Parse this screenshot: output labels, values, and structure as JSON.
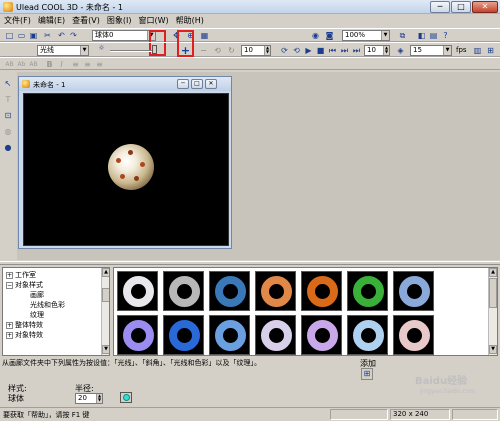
{
  "window": {
    "title": "Ulead COOL 3D - 未命名 - 1",
    "min": "─",
    "max": "□",
    "close": "✕"
  },
  "menu": [
    "文件(F)",
    "编辑(E)",
    "查看(V)",
    "图象(I)",
    "窗口(W)",
    "帮助(H)"
  ],
  "toolbar1": {
    "object_combo": "球体0",
    "zoom_combo": "100%"
  },
  "toolbar2": {
    "light_combo": "光线",
    "spin_a": "10",
    "spin_b": "10",
    "spin_c": "10",
    "frames_combo": "15",
    "fps_label": "fps"
  },
  "doc": {
    "title": "未命名 - 1"
  },
  "tree": {
    "items": [
      {
        "label": "工作室",
        "exp": "+"
      },
      {
        "label": "对象样式",
        "exp": "−"
      },
      {
        "label": "画廊",
        "exp": ""
      },
      {
        "label": "光线和色彩",
        "exp": ""
      },
      {
        "label": "纹理",
        "exp": ""
      },
      {
        "label": "整体特效",
        "exp": "+"
      },
      {
        "label": "对象特效",
        "exp": "+"
      }
    ]
  },
  "thumb_colors": [
    "#e8e8ec",
    "#b8b8b8",
    "#3a78b8",
    "#e0884a",
    "#d86a1a",
    "#3ab03a",
    "#8aa8d8",
    "#9a8cf0",
    "#2a6ad8",
    "#6aa0e0",
    "#d8d0e8",
    "#c8a8e8",
    "#b0d0f0",
    "#e8c8c8"
  ],
  "hint": {
    "text": "从画廊文件夹中下列属性为按设值：「光线」、「斜角」、「光线和色彩」以及「纹理」。"
  },
  "add": {
    "label": "添加",
    "icon": "add-icon"
  },
  "properties": {
    "style_label": "样式:",
    "style_value": "球体",
    "radius_label": "半径:",
    "radius_value": "20",
    "color_hex": "#2ee0d6"
  },
  "status": {
    "text": "要获取「帮助」，请按 F1 键",
    "size": "320 x 240"
  },
  "watermark": {
    "main": "Baidu经验",
    "sub": "jingyan.baidu.com"
  }
}
